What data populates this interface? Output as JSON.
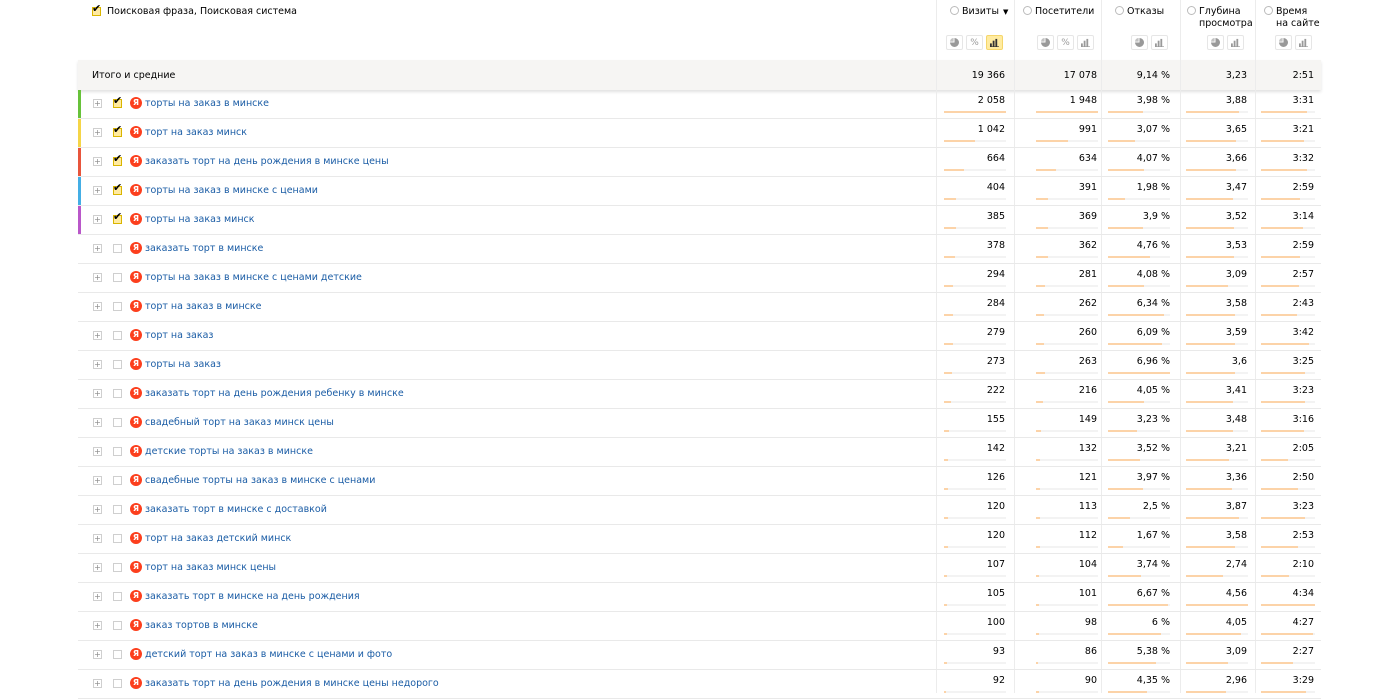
{
  "dimension_label": "Поисковая фраза, Поисковая система",
  "columns": [
    {
      "title": "Визиты",
      "sorted": true,
      "sort_symbol": "▼"
    },
    {
      "title": "Посетители",
      "sorted": false,
      "sort_symbol": ""
    },
    {
      "title": "Отказы",
      "sorted": false,
      "sort_symbol": ""
    },
    {
      "title": "Глубина\nпросмотра",
      "sorted": false,
      "sort_symbol": ""
    },
    {
      "title": "Время\nна сайте",
      "sorted": false,
      "sort_symbol": ""
    }
  ],
  "mode_buttons": {
    "pie": "pie-chart-icon",
    "percent": "%",
    "bars": "bar-chart-icon"
  },
  "totals": {
    "label": "Итого и средние",
    "values": [
      "19 366",
      "17 078",
      "9,14 %",
      "3,23",
      "2:51"
    ]
  },
  "colors": {
    "accent": "#ffeba0",
    "link": "#1a5ca5",
    "yandex": "#fc3f1d",
    "bar": "#fcd3a8"
  },
  "rows": [
    {
      "phrase": "торты на заказ в минске",
      "checked": true,
      "color": "#67c23a",
      "values": [
        "2 058",
        "1 948",
        "3,98 %",
        "3,88",
        "3:31"
      ],
      "bars": [
        1.0,
        1.0,
        0.57,
        0.85,
        0.85
      ]
    },
    {
      "phrase": "торт на заказ минск",
      "checked": true,
      "color": "#f5d547",
      "values": [
        "1 042",
        "991",
        "3,07 %",
        "3,65",
        "3:21"
      ],
      "bars": [
        0.5,
        0.51,
        0.44,
        0.8,
        0.8
      ]
    },
    {
      "phrase": "заказать торт на день рождения в минске цены",
      "checked": true,
      "color": "#e8553c",
      "values": [
        "664",
        "634",
        "4,07 %",
        "3,66",
        "3:32"
      ],
      "bars": [
        0.32,
        0.33,
        0.58,
        0.8,
        0.85
      ]
    },
    {
      "phrase": "торты на заказ в минске с ценами",
      "checked": true,
      "color": "#44aee5",
      "values": [
        "404",
        "391",
        "1,98 %",
        "3,47",
        "2:59"
      ],
      "bars": [
        0.2,
        0.2,
        0.28,
        0.76,
        0.72
      ]
    },
    {
      "phrase": "торты на заказ минск",
      "checked": true,
      "color": "#b957c9",
      "values": [
        "385",
        "369",
        "3,9 %",
        "3,52",
        "3:14"
      ],
      "bars": [
        0.19,
        0.19,
        0.56,
        0.77,
        0.78
      ]
    },
    {
      "phrase": "заказать торт в минске",
      "checked": false,
      "color": "",
      "values": [
        "378",
        "362",
        "4,76 %",
        "3,53",
        "2:59"
      ],
      "bars": [
        0.18,
        0.19,
        0.68,
        0.77,
        0.72
      ]
    },
    {
      "phrase": "торты на заказ в минске с ценами детские",
      "checked": false,
      "color": "",
      "values": [
        "294",
        "281",
        "4,08 %",
        "3,09",
        "2:57"
      ],
      "bars": [
        0.14,
        0.14,
        0.58,
        0.68,
        0.71
      ]
    },
    {
      "phrase": "торт на заказ в минске",
      "checked": false,
      "color": "",
      "values": [
        "284",
        "262",
        "6,34 %",
        "3,58",
        "2:43"
      ],
      "bars": [
        0.14,
        0.13,
        0.91,
        0.79,
        0.66
      ]
    },
    {
      "phrase": "торт на заказ",
      "checked": false,
      "color": "",
      "values": [
        "279",
        "260",
        "6,09 %",
        "3,59",
        "3:42"
      ],
      "bars": [
        0.14,
        0.13,
        0.87,
        0.79,
        0.89
      ]
    },
    {
      "phrase": "торты на заказ",
      "checked": false,
      "color": "",
      "values": [
        "273",
        "263",
        "6,96 %",
        "3,6",
        "3:25"
      ],
      "bars": [
        0.13,
        0.14,
        1.0,
        0.79,
        0.82
      ]
    },
    {
      "phrase": "заказать торт на день рождения ребенку в минске",
      "checked": false,
      "color": "",
      "values": [
        "222",
        "216",
        "4,05 %",
        "3,41",
        "3:23"
      ],
      "bars": [
        0.11,
        0.11,
        0.58,
        0.75,
        0.82
      ]
    },
    {
      "phrase": "свадебный торт на заказ минск цены",
      "checked": false,
      "color": "",
      "values": [
        "155",
        "149",
        "3,23 %",
        "3,48",
        "3:16"
      ],
      "bars": [
        0.08,
        0.08,
        0.46,
        0.76,
        0.79
      ]
    },
    {
      "phrase": "детские торты на заказ в минске",
      "checked": false,
      "color": "",
      "values": [
        "142",
        "132",
        "3,52 %",
        "3,21",
        "2:05"
      ],
      "bars": [
        0.07,
        0.07,
        0.51,
        0.7,
        0.5
      ]
    },
    {
      "phrase": "свадебные торты на заказ в минске с ценами",
      "checked": false,
      "color": "",
      "values": [
        "126",
        "121",
        "3,97 %",
        "3,36",
        "2:50"
      ],
      "bars": [
        0.06,
        0.06,
        0.57,
        0.74,
        0.68
      ]
    },
    {
      "phrase": "заказать торт в минске с доставкой",
      "checked": false,
      "color": "",
      "values": [
        "120",
        "113",
        "2,5 %",
        "3,87",
        "3:23"
      ],
      "bars": [
        0.06,
        0.06,
        0.36,
        0.85,
        0.82
      ]
    },
    {
      "phrase": "торт на заказ детский минск",
      "checked": false,
      "color": "",
      "values": [
        "120",
        "112",
        "1,67 %",
        "3,58",
        "2:53"
      ],
      "bars": [
        0.06,
        0.06,
        0.24,
        0.79,
        0.69
      ]
    },
    {
      "phrase": "торт на заказ минск цены",
      "checked": false,
      "color": "",
      "values": [
        "107",
        "104",
        "3,74 %",
        "2,74",
        "2:10"
      ],
      "bars": [
        0.05,
        0.05,
        0.54,
        0.6,
        0.52
      ]
    },
    {
      "phrase": "заказать торт в минске на день рождения",
      "checked": false,
      "color": "",
      "values": [
        "105",
        "101",
        "6,67 %",
        "4,56",
        "4:34"
      ],
      "bars": [
        0.05,
        0.05,
        0.96,
        1.0,
        1.0
      ]
    },
    {
      "phrase": "заказ тортов в минске",
      "checked": false,
      "color": "",
      "values": [
        "100",
        "98",
        "6 %",
        "4,05",
        "4:27"
      ],
      "bars": [
        0.05,
        0.05,
        0.86,
        0.89,
        0.97
      ]
    },
    {
      "phrase": "детский торт на заказ в минске с ценами и фото",
      "checked": false,
      "color": "",
      "values": [
        "93",
        "86",
        "5,38 %",
        "3,09",
        "2:27"
      ],
      "bars": [
        0.05,
        0.04,
        0.77,
        0.68,
        0.59
      ]
    },
    {
      "phrase": "заказать торт на день рождения в минске цены недорого",
      "checked": false,
      "color": "",
      "values": [
        "92",
        "90",
        "4,35 %",
        "2,96",
        "3:29"
      ],
      "bars": [
        0.04,
        0.05,
        0.63,
        0.65,
        0.84
      ]
    }
  ]
}
